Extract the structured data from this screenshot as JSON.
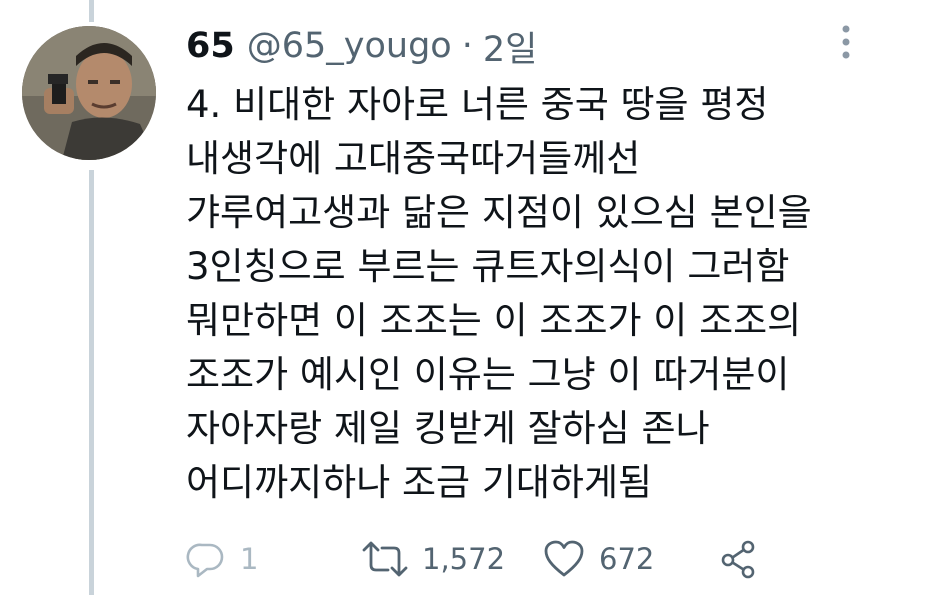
{
  "tweet": {
    "display_name": "65",
    "handle": "@65_yougo",
    "separator": "·",
    "time": "2일",
    "lines": [
      "4. 비대한 자아로 너른 중국 땅을 평정",
      "내생각에 고대중국따거들께선",
      "갸루여고생과 닮은 지점이 있으심 본인을",
      "3인칭으로 부르는 큐트자의식이 그러함",
      "뭐만하면 이 조조는 이 조조가 이 조조의",
      "조조가 예시인 이유는 그냥 이 따거분이",
      "자아자랑 제일 킹받게 잘하심 존나",
      "어디까지하나 조금 기대하게됨"
    ],
    "actions": {
      "reply_count": "1",
      "retweet_count": "1,572",
      "like_count": "672"
    }
  },
  "icons": {
    "more": "more-vertical-icon",
    "reply": "reply-icon",
    "retweet": "retweet-icon",
    "like": "heart-icon",
    "share": "share-icon"
  },
  "colors": {
    "text": "#0f1419",
    "secondary": "#536471",
    "thread_line": "#c9d3da",
    "muted_reply": "#aab8c2"
  }
}
